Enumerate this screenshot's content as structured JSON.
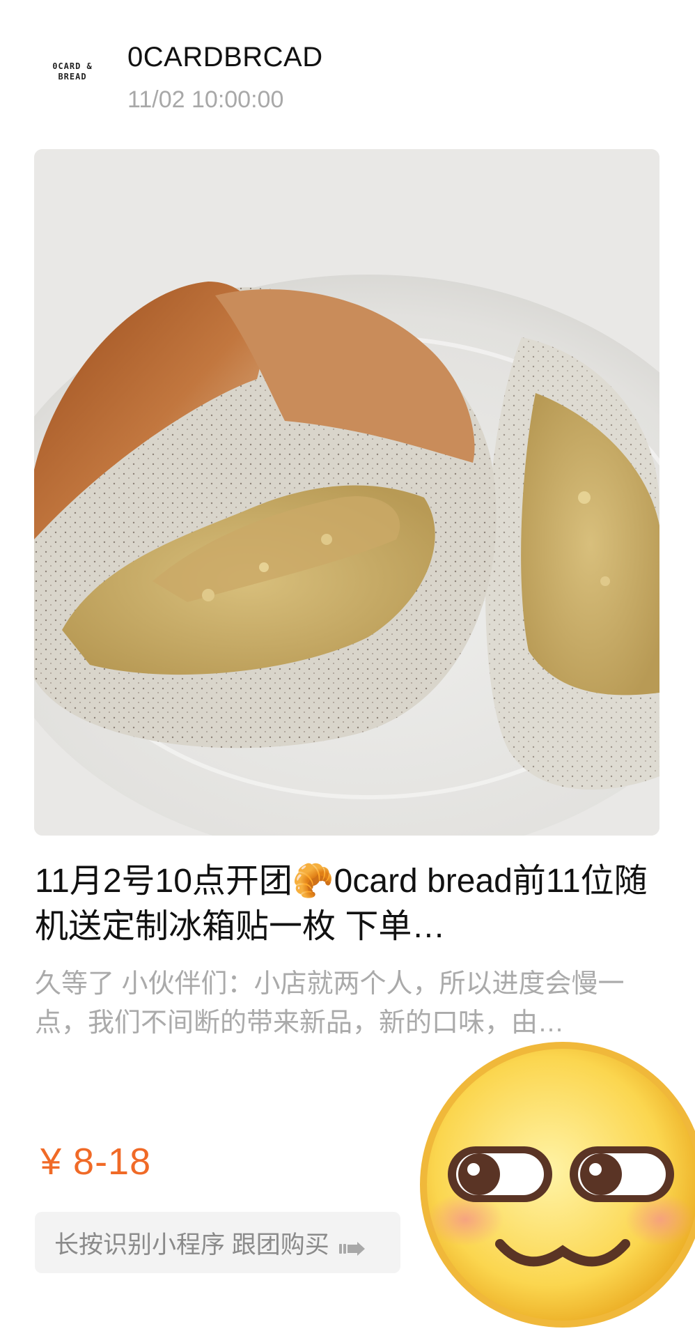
{
  "header": {
    "logo_line1": "0CARD &",
    "logo_line2": "BREAD",
    "shop_name": "0CARDBRCAD",
    "post_time": "11/02 10:00:00"
  },
  "post": {
    "title": "11月2号10点开团🥐0card bread前11位随机送定制冰箱贴一枚 下单…",
    "description": "久等了 小伙伴们：小店就两个人，所以进度会慢一点，我们不间断的带来新品，新的口味，由…",
    "price": "¥ 8-18"
  },
  "cta": {
    "label": "长按识别小程序 跟团购买"
  },
  "colors": {
    "price": "#f06a27",
    "muted_text": "#aaaaaa",
    "cta_bg": "#f3f3f3"
  }
}
